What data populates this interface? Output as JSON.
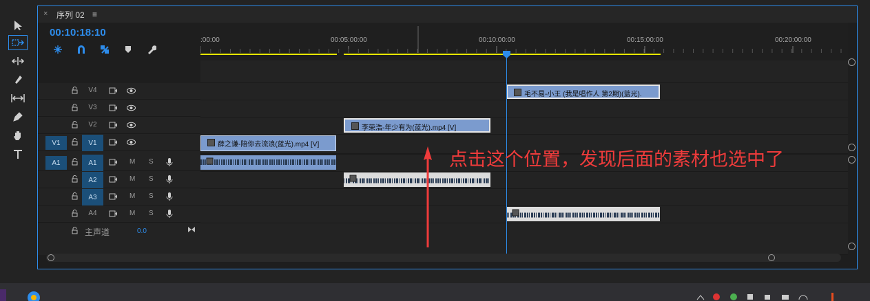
{
  "sequence_tab": {
    "close_glyph": "×",
    "title": "序列 02",
    "menu_glyph": "≡"
  },
  "timecode": "00:10:18:10",
  "ruler": {
    "labels": [
      ":00:00",
      "00:05:00:00",
      "00:10:00:00",
      "00:15:00:00",
      "00:20:00:00"
    ]
  },
  "tracks": {
    "video": [
      {
        "name": "V4"
      },
      {
        "name": "V3"
      },
      {
        "name": "V2"
      },
      {
        "name": "V1",
        "source": "V1"
      }
    ],
    "audio": [
      {
        "name": "A1",
        "source": "A1",
        "m": "M",
        "s": "S"
      },
      {
        "name": "A2",
        "m": "M",
        "s": "S"
      },
      {
        "name": "A3",
        "m": "M",
        "s": "S"
      },
      {
        "name": "A4",
        "m": "M",
        "s": "S"
      }
    ],
    "master": {
      "label": "主声道",
      "value": "0.0"
    }
  },
  "clips": {
    "v4": "毛不易-小王 (我是唱作人 第2期)(蓝光).",
    "v2": "李荣浩-年少有为(蓝光).mp4 [V]",
    "v1": "薛之谦-陪你去流浪(蓝光).mp4 [V]"
  },
  "annotation": "点击这个位置，发现后面的素材也选中了",
  "colors": {
    "accent": "#2d8ceb",
    "video_clip": "#7b9bce",
    "annotation": "#ef3b3b",
    "work_area": "#e8e800"
  },
  "icons": [
    "selection-tool-icon",
    "track-select-forward-icon",
    "ripple-edit-icon",
    "razor-icon",
    "slip-icon",
    "pen-icon",
    "hand-icon",
    "type-icon",
    "nest-icon",
    "snap-icon",
    "linked-selection-icon",
    "add-marker-icon",
    "wrench-icon",
    "lock-icon",
    "sync-lock-icon",
    "eye-icon",
    "mic-icon"
  ]
}
